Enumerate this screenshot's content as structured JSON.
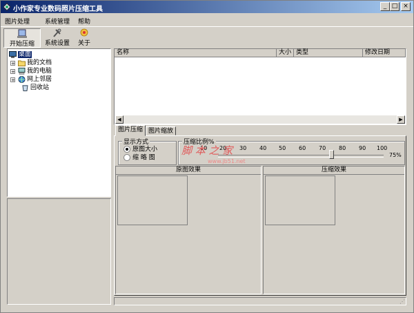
{
  "window": {
    "title": "小作家专业数码照片压缩工具"
  },
  "menu": [
    "图片处理",
    "系统管理",
    "帮助"
  ],
  "toolbar": [
    {
      "label": "开始压缩",
      "icon": "compress-icon"
    },
    {
      "label": "系统设置",
      "icon": "settings-icon"
    },
    {
      "label": "关于",
      "icon": "about-icon"
    }
  ],
  "tree": {
    "root": "桌面",
    "items": [
      "我的文档",
      "我的电脑",
      "网上邻居",
      "回收站"
    ]
  },
  "file_list": {
    "columns": [
      "名称",
      "大小",
      "类型",
      "修改日期"
    ]
  },
  "tabs": [
    "图片压缩",
    "图片缩放"
  ],
  "display_mode": {
    "legend": "显示方式",
    "options": [
      "原图大小",
      "缩 略 图"
    ],
    "selected": 0
  },
  "compression": {
    "legend": "压缩比例%",
    "ticks": [
      "10",
      "20",
      "30",
      "40",
      "50",
      "60",
      "70",
      "80",
      "90",
      "100"
    ],
    "value": 75,
    "value_label": "75%"
  },
  "watermark": {
    "text": "脚 本 之 家",
    "url": "www.jb51.net"
  },
  "panes": {
    "original": "原图效果",
    "compressed": "压缩效果"
  }
}
